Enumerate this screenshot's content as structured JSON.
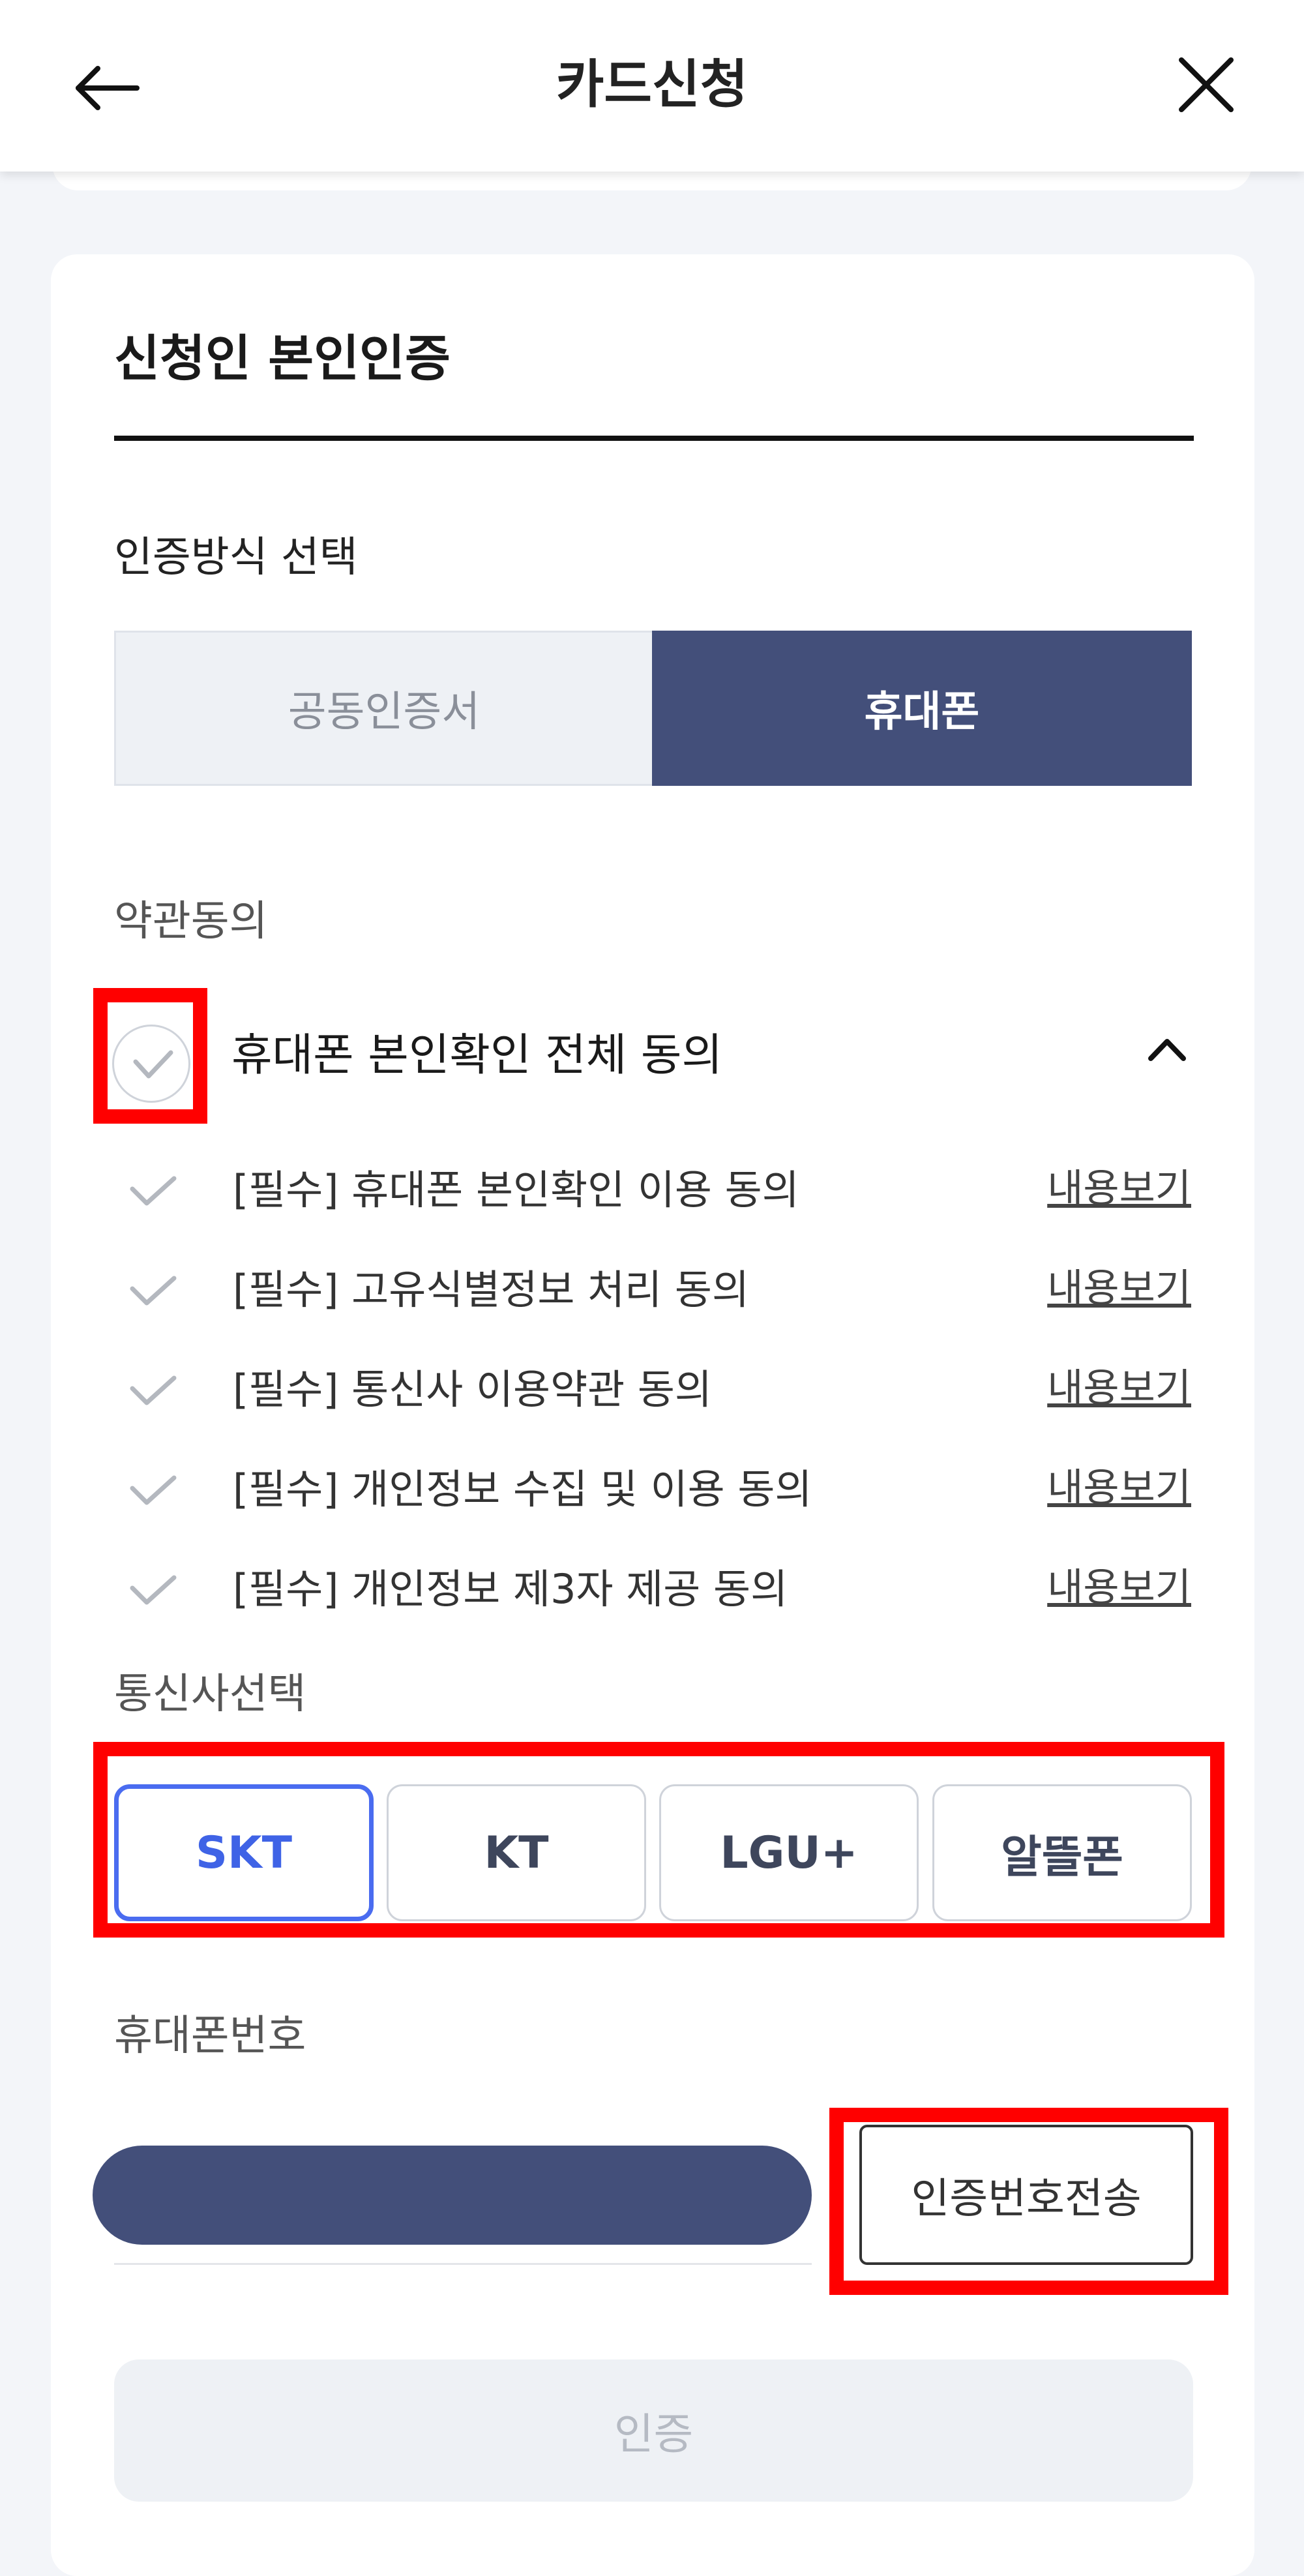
{
  "header": {
    "title": "카드신청",
    "back_icon": "arrow-left-icon",
    "close_icon": "close-icon"
  },
  "section": {
    "title": "신청인 본인인증"
  },
  "auth_method": {
    "label": "인증방식 선택",
    "options": [
      "공동인증서",
      "휴대폰"
    ],
    "selected": "휴대폰"
  },
  "terms": {
    "label": "약관동의",
    "agree_all": "휴대폰 본인확인 전체 동의",
    "items": [
      {
        "label": "[필수] 휴대폰 본인확인 이용 동의",
        "link": "내용보기"
      },
      {
        "label": "[필수] 고유식별정보 처리 동의",
        "link": "내용보기"
      },
      {
        "label": "[필수] 통신사 이용약관 동의",
        "link": "내용보기"
      },
      {
        "label": "[필수] 개인정보 수집 및 이용 동의",
        "link": "내용보기"
      },
      {
        "label": "[필수] 개인정보 제3자 제공 동의",
        "link": "내용보기"
      }
    ]
  },
  "carrier": {
    "label": "통신사선택",
    "options": [
      "SKT",
      "KT",
      "LGU+",
      "알뜰폰"
    ],
    "selected": "SKT"
  },
  "phone": {
    "label": "휴대폰번호",
    "value": "",
    "send_button": "인증번호전송"
  },
  "submit": {
    "label": "인증"
  },
  "colors": {
    "navy": "#434f7a",
    "selected_blue": "#3f63e6",
    "highlight_red": "#ff0000",
    "disabled_text": "#b5bac3"
  }
}
